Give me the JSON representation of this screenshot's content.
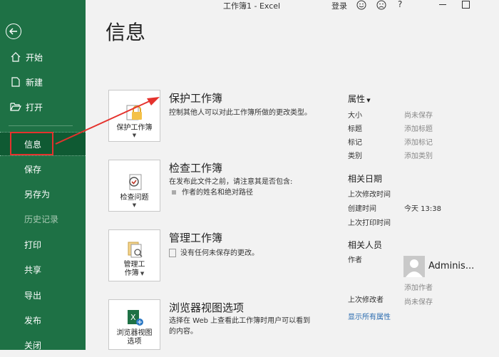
{
  "titlebar": {
    "title": "工作簿1 - Excel",
    "login": "登录",
    "help": "?"
  },
  "sidebar": {
    "items": [
      {
        "label": "开始",
        "icon": "home-icon"
      },
      {
        "label": "新建",
        "icon": "new-document-icon"
      },
      {
        "label": "打开",
        "icon": "folder-open-icon"
      },
      {
        "label": "信息"
      },
      {
        "label": "保存"
      },
      {
        "label": "另存为"
      },
      {
        "label": "历史记录"
      },
      {
        "label": "打印"
      },
      {
        "label": "共享"
      },
      {
        "label": "导出"
      },
      {
        "label": "发布"
      },
      {
        "label": "关闭"
      }
    ],
    "active": "信息"
  },
  "page": {
    "title": "信息"
  },
  "sections": {
    "protect": {
      "tile_line1": "保护工作簿",
      "title": "保护工作簿",
      "desc": "控制其他人可以对此工作簿所做的更改类型。"
    },
    "inspect": {
      "tile_line1": "检查问题",
      "title": "检查工作簿",
      "desc": "在发布此文件之前，请注意其是否包含:",
      "bullet": "作者的姓名和绝对路径"
    },
    "manage": {
      "tile_line1": "管理工",
      "tile_line2": "作簿",
      "title": "管理工作簿",
      "desc": "没有任何未保存的更改。"
    },
    "browser": {
      "tile_line1": "浏览器视图",
      "tile_line2": "选项",
      "title": "浏览器视图选项",
      "desc": "选择在 Web 上查看此工作簿时用户可以看到的内容。"
    }
  },
  "properties": {
    "heading": "属性",
    "rows": [
      {
        "key": "大小",
        "value": "尚未保存"
      },
      {
        "key": "标题",
        "value": "添加标题"
      },
      {
        "key": "标记",
        "value": "添加标记"
      },
      {
        "key": "类别",
        "value": "添加类别"
      }
    ],
    "dates_heading": "相关日期",
    "dates": [
      {
        "key": "上次修改时间",
        "value": ""
      },
      {
        "key": "创建时间",
        "value": "今天 13:38"
      },
      {
        "key": "上次打印时间",
        "value": ""
      }
    ],
    "people_heading": "相关人员",
    "author_key": "作者",
    "author_name": "Adminis...",
    "add_author": "添加作者",
    "last_modified_by_key": "上次修改者",
    "last_modified_by_value": "尚未保存",
    "show_all": "显示所有属性"
  },
  "colors": {
    "sidebar": "#1e7145",
    "active": "#0f5a33",
    "annotation": "#e5322d",
    "link": "#2b6cb0"
  }
}
